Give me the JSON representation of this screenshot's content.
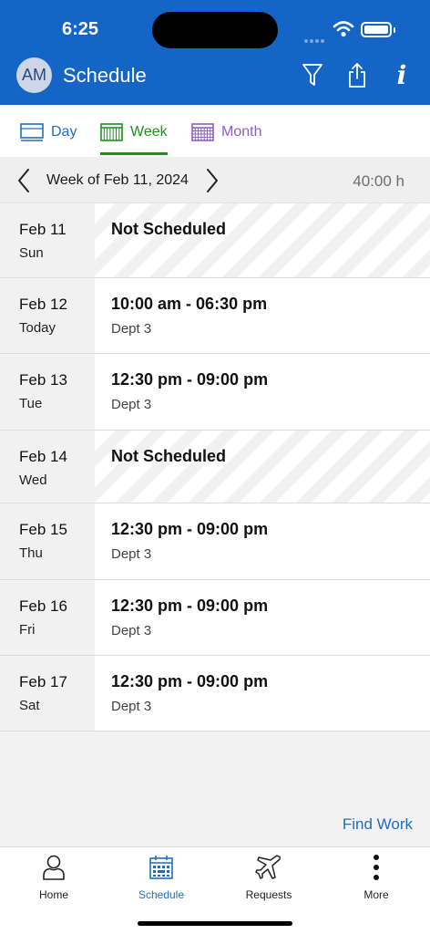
{
  "status_bar": {
    "time": "6:25"
  },
  "header": {
    "avatar_initials": "AM",
    "title": "Schedule",
    "actions": [
      {
        "icon": "filter-icon"
      },
      {
        "icon": "share-icon"
      },
      {
        "icon": "info-icon",
        "glyph": "i"
      }
    ]
  },
  "view_tabs": [
    {
      "label": "Day",
      "color": "#1f6fc1",
      "icon": "day-view-icon"
    },
    {
      "label": "Week",
      "color": "#1f8f22",
      "icon": "week-view-icon",
      "selected": true
    },
    {
      "label": "Month",
      "color": "#8c5fc3",
      "icon": "month-view-icon"
    }
  ],
  "week_nav": {
    "label": "Week of Feb 11, 2024",
    "total_hours": "40:00 h"
  },
  "days": [
    {
      "date": "Feb 11",
      "weekday": "Sun",
      "shift": "Not Scheduled",
      "dept": "",
      "scheduled": false
    },
    {
      "date": "Feb 12",
      "weekday": "Today",
      "shift": "10:00 am - 06:30 pm",
      "dept": "Dept 3",
      "scheduled": true
    },
    {
      "date": "Feb 13",
      "weekday": "Tue",
      "shift": "12:30 pm - 09:00 pm",
      "dept": "Dept 3",
      "scheduled": true
    },
    {
      "date": "Feb 14",
      "weekday": "Wed",
      "shift": "Not Scheduled",
      "dept": "",
      "scheduled": false
    },
    {
      "date": "Feb 15",
      "weekday": "Thu",
      "shift": "12:30 pm - 09:00 pm",
      "dept": "Dept 3",
      "scheduled": true
    },
    {
      "date": "Feb 16",
      "weekday": "Fri",
      "shift": "12:30 pm - 09:00 pm",
      "dept": "Dept 3",
      "scheduled": true
    },
    {
      "date": "Feb 17",
      "weekday": "Sat",
      "shift": "12:30 pm - 09:00 pm",
      "dept": "Dept 3",
      "scheduled": true
    }
  ],
  "find_work_label": "Find Work",
  "bottom_nav": [
    {
      "label": "Home",
      "icon": "person-icon"
    },
    {
      "label": "Schedule",
      "icon": "calendar-icon",
      "active": true
    },
    {
      "label": "Requests",
      "icon": "airplane-icon"
    },
    {
      "label": "More",
      "icon": "more-vertical-icon"
    }
  ],
  "colors": {
    "brand_blue": "#1565c7",
    "link_blue": "#1f6fc1",
    "week_green": "#1f8f22",
    "month_purple": "#8c5fc3"
  }
}
